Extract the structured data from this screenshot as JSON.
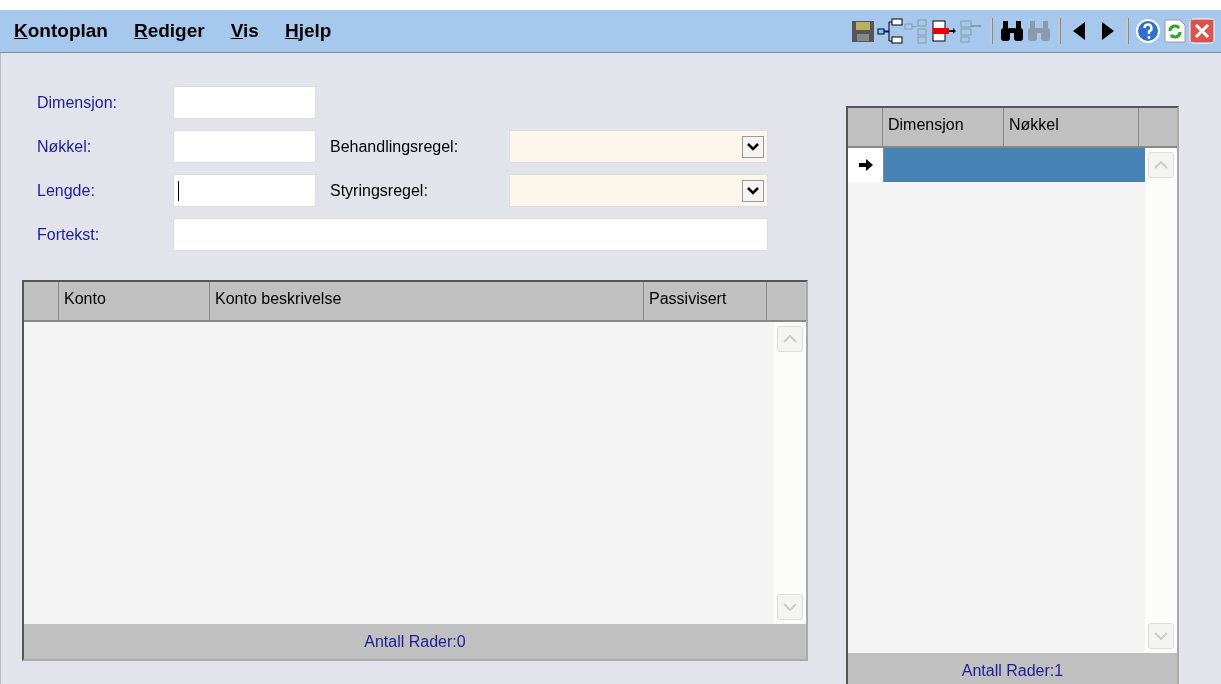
{
  "menu": [
    {
      "label": "Kontoplan"
    },
    {
      "label": "Rediger"
    },
    {
      "label": "Vis"
    },
    {
      "label": "Hjelp"
    }
  ],
  "toolbar": [
    {
      "kind": "save",
      "disabled": false
    },
    {
      "kind": "insert",
      "disabled": false
    },
    {
      "kind": "insert-child",
      "disabled": true
    },
    {
      "kind": "delete",
      "disabled": false
    },
    {
      "kind": "move",
      "disabled": true
    },
    {
      "kind": "sep"
    },
    {
      "kind": "find",
      "disabled": false
    },
    {
      "kind": "find-again",
      "disabled": true
    },
    {
      "kind": "sep"
    },
    {
      "kind": "prev",
      "disabled": false
    },
    {
      "kind": "next",
      "disabled": false
    },
    {
      "kind": "sep"
    },
    {
      "kind": "help",
      "disabled": false
    },
    {
      "kind": "refresh",
      "disabled": false
    },
    {
      "kind": "close",
      "disabled": false
    }
  ],
  "form": {
    "dimensjon": {
      "label": "Dimensjon:"
    },
    "nokkel": {
      "label": "Nøkkel:"
    },
    "lengde": {
      "label": "Lengde:",
      "focused": true
    },
    "behandlingsregel": {
      "label": "Behandlingsregel:"
    },
    "styringsregel": {
      "label": "Styringsregel:"
    },
    "fortekst": {
      "label": "Fortekst:"
    }
  },
  "konto_grid": {
    "columns": [
      "Konto",
      "Konto beskrivelse",
      "Passivisert"
    ],
    "footer": "Antall Rader:0"
  },
  "dimensjon_grid": {
    "columns": [
      "Dimensjon",
      "Nøkkel"
    ],
    "rows": [
      {
        "selected": true
      }
    ],
    "footer": "Antall Rader:1"
  }
}
